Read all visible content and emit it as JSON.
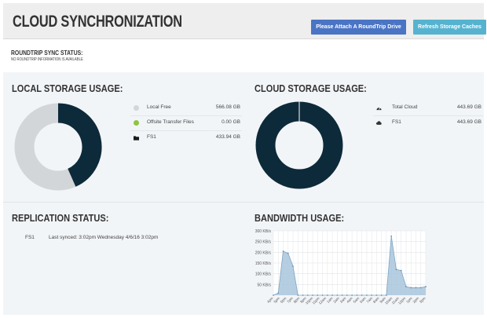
{
  "header": {
    "title": "CLOUD SYNCHRONIZATION",
    "attach_button": "Please Attach A RoundTrip Drive",
    "refresh_button": "Refresh Storage Caches"
  },
  "roundtrip": {
    "title": "ROUNDTRIP SYNC STATUS:",
    "status": "NO ROUNDTRIP INFORMATION IS AVAILABLE"
  },
  "colors": {
    "dark": "#0d2a3a",
    "light_gray": "#d3d6d9",
    "offsite_green": "#8dc63f",
    "attach_blue": "#4a74c4",
    "refresh_cyan": "#55b3d0",
    "chart_fill": "#a9c6dc"
  },
  "local_storage": {
    "title": "LOCAL STORAGE USAGE:",
    "items": [
      {
        "label": "Local Free",
        "value": "566.08 GB",
        "icon": "gray-dot-icon",
        "gb": 566.08
      },
      {
        "label": "Offsite Transfer Files",
        "value": "0.00 GB",
        "icon": "green-dot-icon",
        "gb": 0.0
      },
      {
        "label": "FS1",
        "value": "433.94 GB",
        "icon": "folder-icon",
        "gb": 433.94
      }
    ]
  },
  "cloud_storage": {
    "title": "CLOUD STORAGE USAGE:",
    "items": [
      {
        "label": "Total Cloud",
        "value": "443.69 GB",
        "icon": "gauge-icon"
      },
      {
        "label": "FS1",
        "value": "443.69 GB",
        "icon": "cloud-icon"
      }
    ]
  },
  "replication": {
    "title": "REPLICATION STATUS:",
    "items": [
      {
        "name": "FS1",
        "status": "Last synced: 3:02pm Wednesday 4/6/16 3:02pm"
      }
    ]
  },
  "bandwidth": {
    "title": "BANDWIDTH USAGE:"
  },
  "chart_data": {
    "type": "area",
    "title": "BANDWIDTH USAGE:",
    "ylim": [
      0,
      300
    ],
    "y_ticks": [
      "300 KB/s",
      "250 KB/s",
      "200 KB/s",
      "150 KB/s",
      "100 KB/s",
      "50 KB/s"
    ],
    "y_tick_values": [
      300,
      250,
      200,
      150,
      100,
      50
    ],
    "x": [
      "4pm",
      "5pm",
      "6pm",
      "7pm",
      "8pm",
      "9pm",
      "10pm",
      "11pm",
      "12am",
      "1am",
      "2am",
      "3am",
      "4am",
      "5am",
      "6am",
      "7am",
      "8am",
      "9am",
      "10am",
      "11am",
      "12pm",
      "1pm",
      "2pm",
      "3pm"
    ],
    "series": [
      {
        "values": [
          0,
          10,
          205,
          195,
          135,
          0,
          0,
          0,
          0,
          0,
          0,
          0,
          0,
          0,
          0,
          0,
          0,
          0,
          0,
          0,
          0,
          0,
          0,
          0,
          275,
          120,
          115,
          40,
          35,
          35,
          35,
          40
        ]
      }
    ],
    "grid": true
  }
}
